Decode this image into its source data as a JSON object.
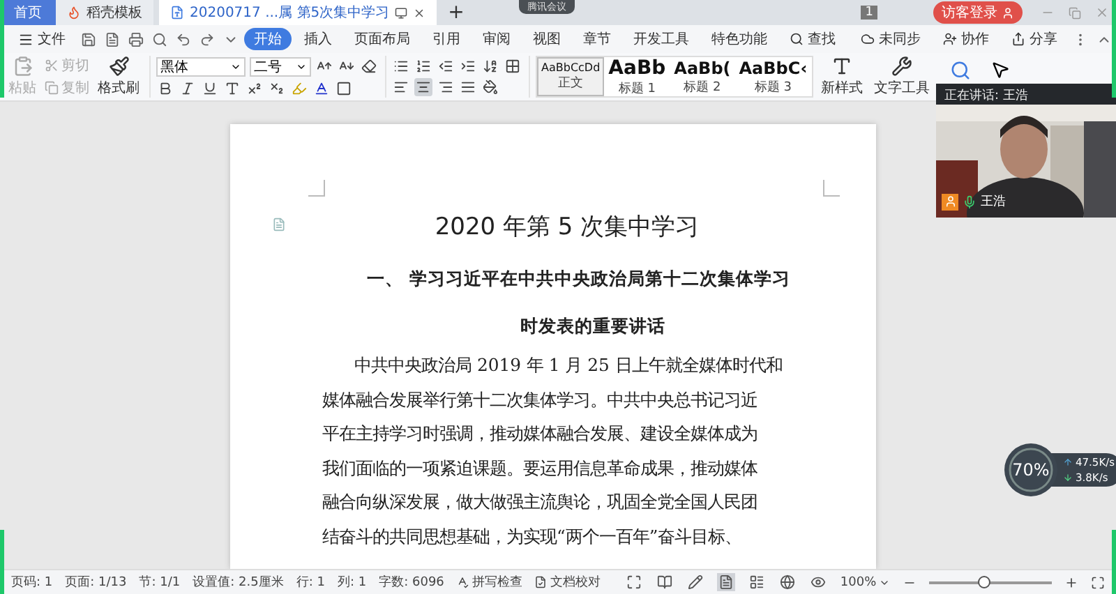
{
  "tabs": [
    {
      "label": "首页",
      "kind": "home",
      "selected": false
    },
    {
      "label": "稻壳模板",
      "kind": "template",
      "selected": false
    },
    {
      "label": "20200717 ...属 第5次集中学习",
      "kind": "doc",
      "selected": true
    }
  ],
  "new_tab": "+",
  "meeting_pill": "腾讯会议",
  "window_badge": "1",
  "login_button": "访客登录",
  "menu": {
    "file": "文件",
    "tabs": [
      {
        "label": "开始",
        "selected": true
      },
      {
        "label": "插入",
        "selected": false
      },
      {
        "label": "页面布局",
        "selected": false
      },
      {
        "label": "引用",
        "selected": false
      },
      {
        "label": "审阅",
        "selected": false
      },
      {
        "label": "视图",
        "selected": false
      },
      {
        "label": "章节",
        "selected": false
      },
      {
        "label": "开发工具",
        "selected": false
      },
      {
        "label": "特色功能",
        "selected": false
      }
    ],
    "search": "查找",
    "actions": [
      {
        "label": "未同步",
        "kind": "cloud"
      },
      {
        "label": "协作",
        "kind": "person"
      },
      {
        "label": "分享",
        "kind": "share"
      }
    ]
  },
  "ribbon": {
    "clipboard": [
      {
        "label": "粘贴",
        "kind": "paste",
        "disabled": true
      },
      {
        "label": "剪切",
        "kind": "cut",
        "disabled": true
      },
      {
        "label": "复制",
        "kind": "copy",
        "disabled": true
      },
      {
        "label": "格式刷",
        "kind": "brush",
        "disabled": false
      }
    ],
    "font": "黑体",
    "size": "二号",
    "align": [
      {
        "kind": "left",
        "selected": false
      },
      {
        "kind": "center",
        "selected": true
      },
      {
        "kind": "right",
        "selected": false
      },
      {
        "kind": "justify",
        "selected": false
      }
    ],
    "styles": [
      {
        "preview": "AaBbCcDd",
        "label": "正文",
        "kind": "body",
        "selected": true
      },
      {
        "preview": "AaBb",
        "label": "标题 1",
        "kind": "h1",
        "selected": false
      },
      {
        "preview": "AaBb(",
        "label": "标题 2",
        "kind": "h2",
        "selected": false
      },
      {
        "preview": "AaBbC‹",
        "label": "标题 3",
        "kind": "h3",
        "selected": false
      }
    ],
    "new_style": "新样式",
    "text_tool": "文字工具"
  },
  "document": {
    "title": "2020 年第 5 次集中学习",
    "heading": [
      "一、 学习习近平在中共中央政治局第十二次集体学习",
      "时发表的重要讲话"
    ],
    "lines": [
      "中共中央政治局 2019 年 1 月 25 日上午就全媒体时代和",
      "媒体融合发展举行第十二次集体学习。中共中央总书记习近",
      "平在主持学习时强调，推动媒体融合发展、建设全媒体成为",
      "我们面临的一项紧迫课题。要运用信息革命成果，推动媒体",
      "融合向纵深发展，做大做强主流舆论，巩固全党全国人民团",
      "结奋斗的共同思想基础，为实现“两个一百年”奋斗目标、"
    ]
  },
  "speaker_panel": {
    "header": "正在讲话: 王浩",
    "name": "王浩"
  },
  "speed_widget": {
    "load": "70%",
    "upload": "47.5K/s",
    "download": "3.8K/s"
  },
  "status_bar": {
    "items": [
      "页码: 1",
      "页面: 1/13",
      "节: 1/1",
      "设置值: 2.5厘米",
      "行: 1",
      "列: 1",
      "字数: 6096"
    ],
    "tools": [
      {
        "label": "拼写检查"
      },
      {
        "label": "文档校对"
      }
    ],
    "views": [
      {
        "kind": "fullscreen",
        "selected": false
      },
      {
        "kind": "read",
        "selected": false
      },
      {
        "kind": "write",
        "selected": false
      },
      {
        "kind": "page",
        "selected": true
      },
      {
        "kind": "outline",
        "selected": false
      },
      {
        "kind": "web",
        "selected": false
      },
      {
        "kind": "eye",
        "selected": false
      }
    ],
    "zoom": "100%",
    "zoom_level": {
      "level": 0.44
    }
  }
}
